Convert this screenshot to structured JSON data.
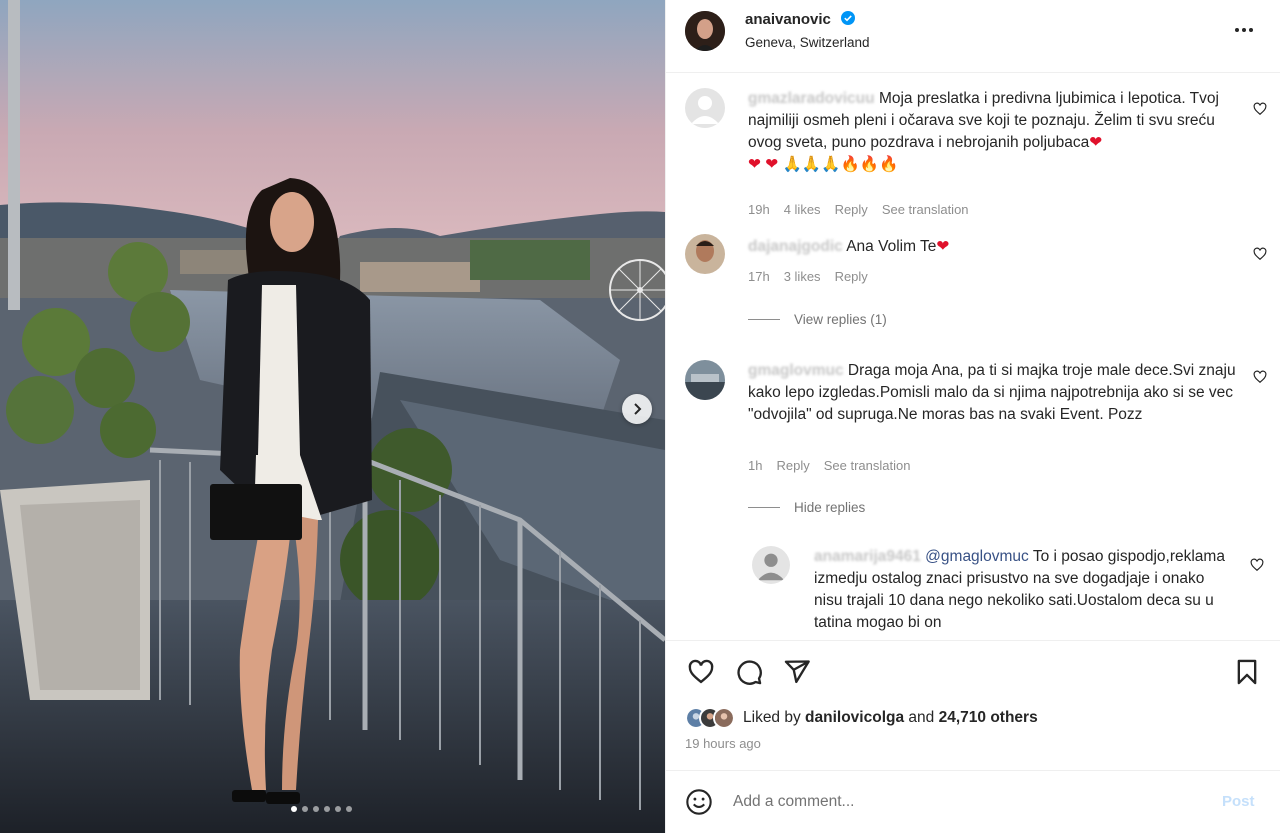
{
  "header": {
    "username": "anaivanovic",
    "verified_icon": "verified-badge-icon",
    "location": "Geneva, Switzerland",
    "more_icon": "more-options-icon"
  },
  "comments": [
    {
      "username": "gmazlaradovicuu",
      "text": "Moja preslatka i predivna ljubimica i lepotica. Tvoj najmiliji osmeh pleni i očarava sve koji te poznaju. Želim ti svu sreću ovog sveta, puno pozdrava i nebrojanih poljubaca",
      "emoji": "❤️❤️❤️🙏🙏🙏🔥🔥🔥",
      "time": "19h",
      "likes": "4 likes",
      "reply": "Reply",
      "see_translation": "See translation"
    },
    {
      "username": "dajanajgodic",
      "text": "Ana Volim Te",
      "time": "17h",
      "likes": "3 likes",
      "reply": "Reply",
      "view_replies": "View replies (1)"
    },
    {
      "username": "gmaglovmuc",
      "text": "Draga moja Ana, pa ti si majka troje male dece.Svi znaju kako lepo izgledas.Pomisli malo da si njima najpotrebnija ako si se vec \"odvojila\" od supruga.Ne moras bas na svaki Event. Pozz",
      "time": "1h",
      "reply": "Reply",
      "see_translation": "See translation",
      "hide_replies": "Hide replies"
    },
    {
      "username": "anamarija9461",
      "mention": "@gmaglovmuc",
      "text": "To i posao gispodjo,reklama izmedju ostalog znaci prisustvo na sve dogadjaje i onako nisu trajali 10 dana nego nekoliko sati.Uostalom deca su u tatina mogao bi on"
    }
  ],
  "actions": {
    "like_icon": "heart-icon",
    "comment_icon": "comment-icon",
    "share_icon": "share-icon",
    "save_icon": "bookmark-icon",
    "liked_by_prefix": "Liked by",
    "liked_by_user": "danilovicolga",
    "liked_by_and": "and",
    "liked_by_others": "24,710 others",
    "timestamp": "19 hours ago"
  },
  "add_comment": {
    "emoji_icon": "emoji-icon",
    "placeholder": "Add a comment...",
    "post_label": "Post"
  },
  "media": {
    "carousel_dots": 6,
    "active_dot": 0,
    "next_icon": "chevron-right-icon"
  }
}
